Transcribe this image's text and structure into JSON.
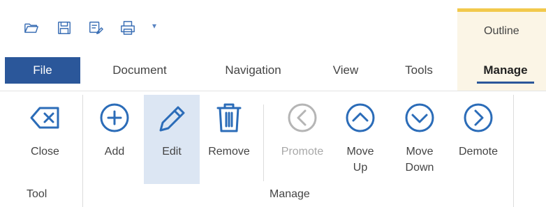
{
  "qat": {
    "items": [
      {
        "name": "open-icon"
      },
      {
        "name": "save-icon"
      },
      {
        "name": "save-as-icon"
      },
      {
        "name": "print-icon"
      }
    ],
    "customize": "▾"
  },
  "contextual_tab": {
    "label": "Outline",
    "accent": "#f2c94c",
    "bg": "#fbf5e6"
  },
  "tabs": {
    "file": "File",
    "document": "Document",
    "navigation": "Navigation",
    "view": "View",
    "tools": "Tools",
    "manage": "Manage",
    "active": "Manage"
  },
  "ribbon": {
    "tool_group": {
      "label": "Tool",
      "buttons": {
        "close": "Close"
      }
    },
    "manage_group": {
      "label": "Manage",
      "buttons": {
        "add": "Add",
        "edit": "Edit",
        "remove": "Remove",
        "promote": "Promote",
        "move_up": "Move\nUp",
        "move_down": "Move\nDown",
        "demote": "Demote"
      },
      "selected": "Edit",
      "disabled": [
        "Promote"
      ]
    }
  },
  "colors": {
    "accent": "#2b579a",
    "icon": "#2b6cb8",
    "disabled": "#b5b5b5",
    "selected_bg": "#dce6f3"
  }
}
